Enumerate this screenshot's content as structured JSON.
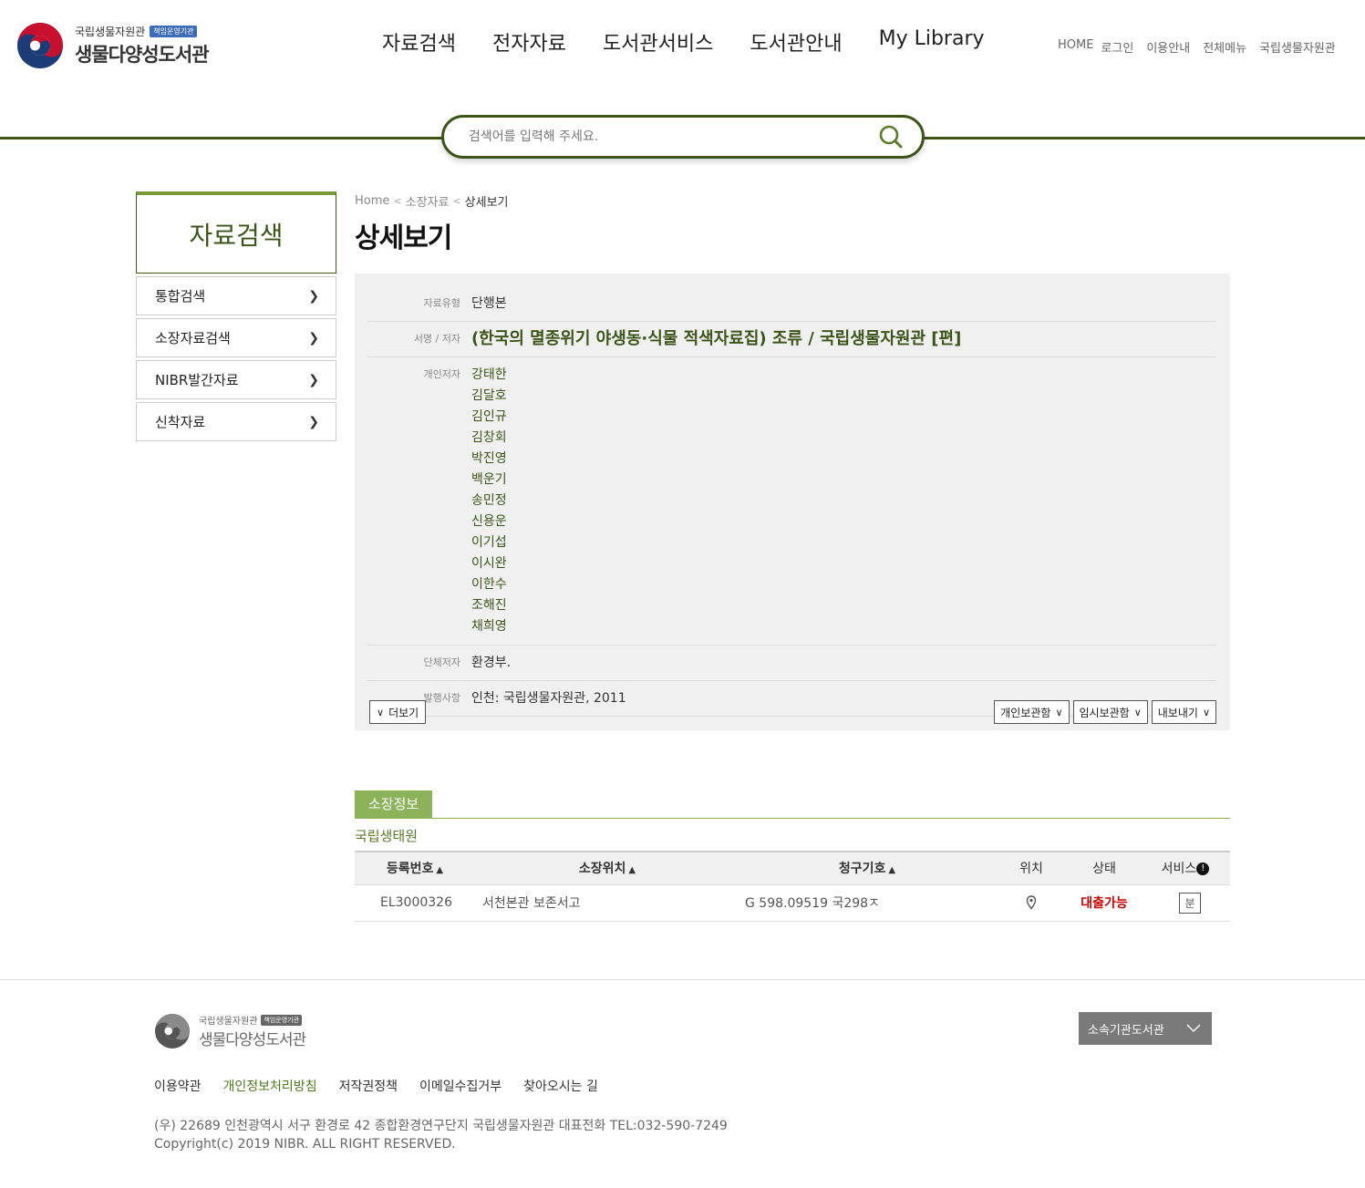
{
  "header": {
    "logo_top": "국립생물자원관",
    "logo_badge": "책임운영기관",
    "logo_main": "생물다양성도서관",
    "gnb": [
      "자료검색",
      "전자자료",
      "도서관서비스",
      "도서관안내",
      "My Library"
    ],
    "util": [
      "HOME",
      "로그인",
      "이용안내",
      "전체메뉴",
      "국립생물자원관"
    ]
  },
  "search": {
    "placeholder": "검색어를 입력해 주세요."
  },
  "lnb": {
    "title": "자료검색",
    "items": [
      "통합검색",
      "소장자료검색",
      "NIBR발간자료",
      "신착자료"
    ]
  },
  "breadcrumb": {
    "home": "Home",
    "parent": "소장자료",
    "current": "상세보기"
  },
  "page_title": "상세보기",
  "detail": {
    "type_label": "자료유형",
    "type_value": "단행본",
    "title_label": "서명 / 저자",
    "title_value": "(한국의 멸종위기 야생동·식물 적색자료집) 조류 / 국립생물자원관 [편]",
    "authors_label": "개인저자",
    "authors": [
      "강태한",
      "김달호",
      "김인규",
      "김창회",
      "박진영",
      "백운기",
      "송민정",
      "신용운",
      "이기섭",
      "이시완",
      "이한수",
      "조해진",
      "채희영"
    ],
    "org_label": "단체저자",
    "org_value": "환경부.",
    "pub_label": "발행사항",
    "pub_value": "인천: 국립생물자원관, 2011",
    "more": "더보기",
    "buttons": [
      "개인보관함",
      "임시보관함",
      "내보내기"
    ]
  },
  "holdings": {
    "tab": "소장정보",
    "org": "국립생태원",
    "columns": [
      "등록번호",
      "소장위치",
      "청구기호",
      "위치",
      "상태",
      "서비스"
    ],
    "row": {
      "reg_no": "EL3000326",
      "location": "서천본관 보존서고",
      "call_no": "G 598.09519 국298ㅈ",
      "status": "대출가능",
      "service": "분"
    }
  },
  "footer": {
    "logo_top": "국립생물자원관",
    "logo_badge": "책임운영기관",
    "logo_main": "생물다양성도서관",
    "select": "소속기관도서관",
    "links": [
      "이용약관",
      "개인정보처리방침",
      "저작권정책",
      "이메일수집거부",
      "찾아오시는 길"
    ],
    "address": "(우) 22689 인천광역시 서구 환경로 42 종합환경연구단지 국립생물자원관 대표전화 TEL:032-590-7249",
    "copyright": "Copyright(c) 2019 NIBR. ALL RIGHT RESERVED."
  },
  "colors": {
    "brand_green": "#3d5418",
    "accent_green": "#8db35a",
    "status_red": "#cc0000"
  }
}
